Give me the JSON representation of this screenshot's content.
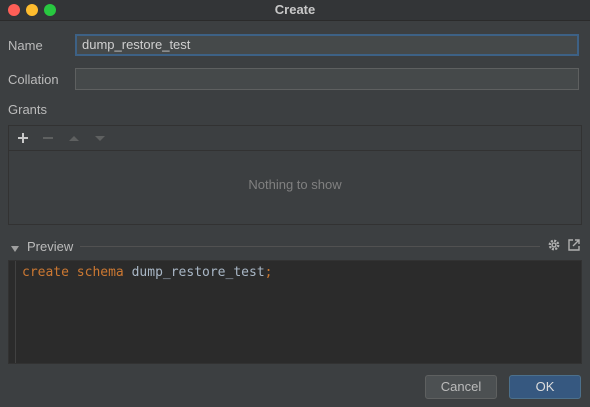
{
  "window": {
    "title": "Create"
  },
  "form": {
    "name_label": "Name",
    "name_value": "dump_restore_test",
    "collation_label": "Collation",
    "collation_value": ""
  },
  "grants": {
    "label": "Grants",
    "empty_text": "Nothing to show",
    "toolbar": [
      "add-icon",
      "remove-icon",
      "move-up-icon",
      "move-down-icon"
    ]
  },
  "preview": {
    "label": "Preview",
    "code": {
      "kw1": "create",
      "kw2": "schema",
      "ident": "dump_restore_test",
      "end": ";"
    }
  },
  "buttons": {
    "cancel": "Cancel",
    "ok": "OK"
  },
  "colors": {
    "accent": "#365880",
    "keyword": "#cc7832",
    "background": "#3c3f41",
    "editor_bg": "#2b2b2b"
  }
}
